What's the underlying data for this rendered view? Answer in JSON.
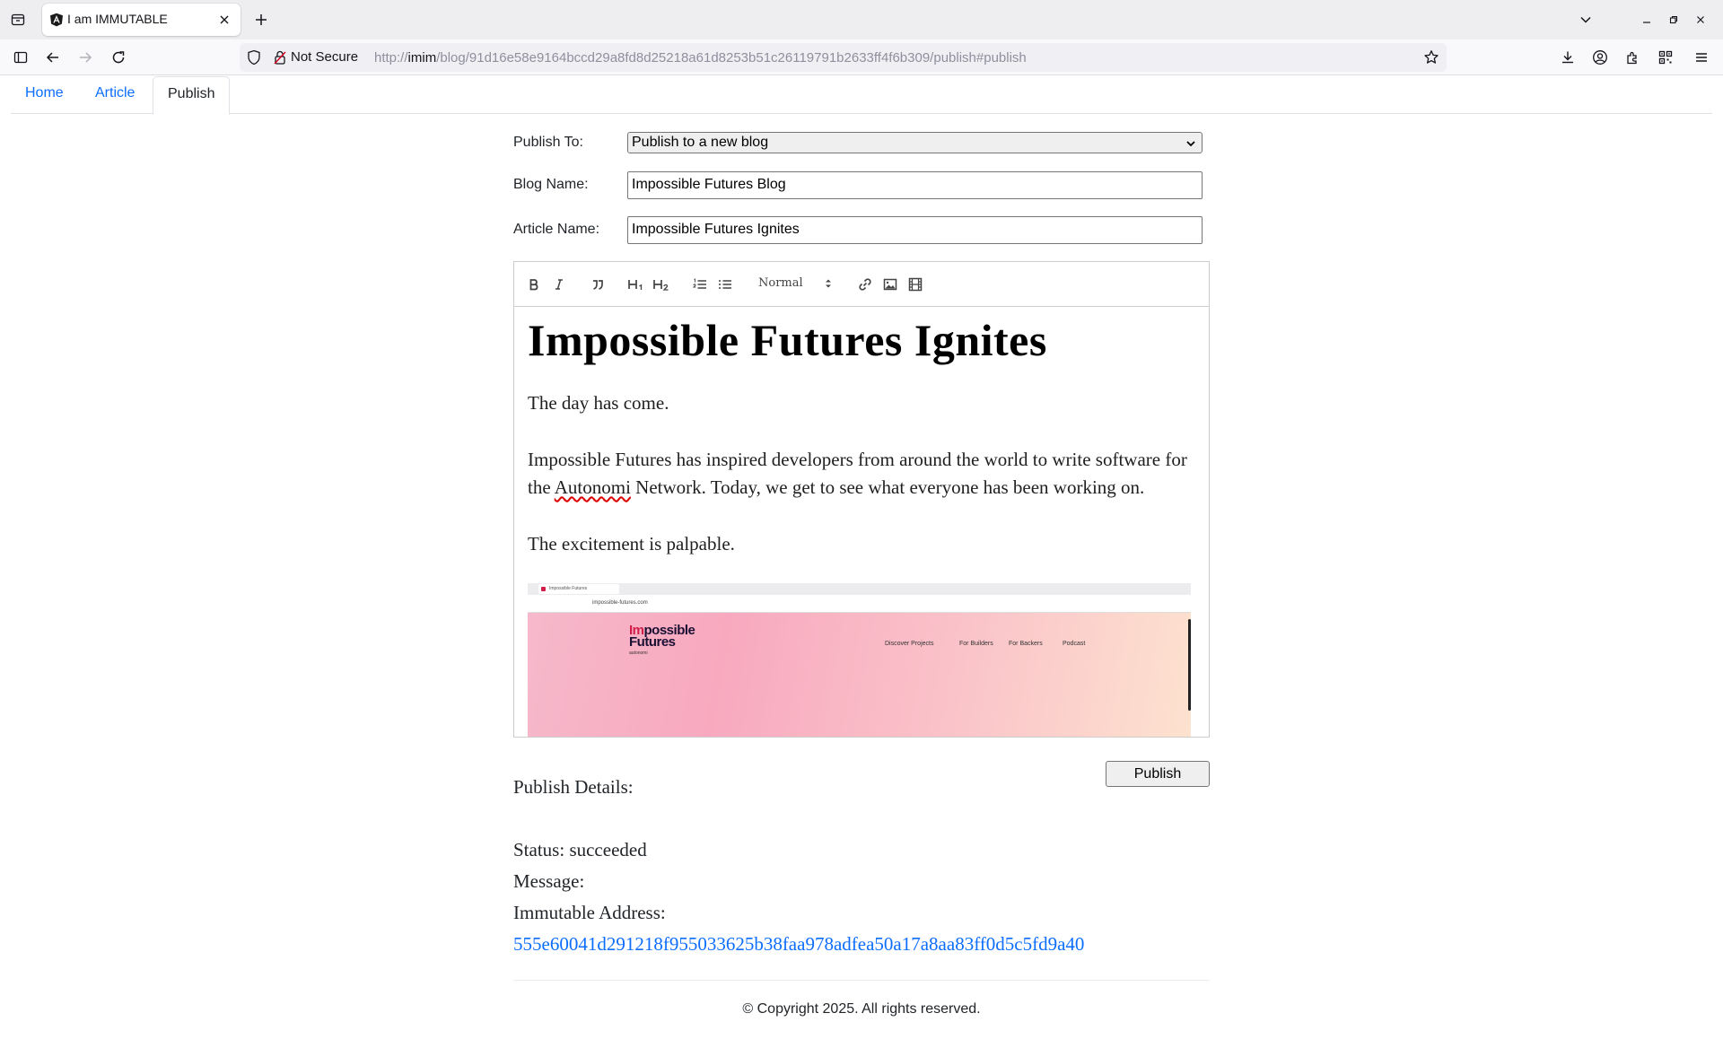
{
  "browser": {
    "tab_title": "I am IMMUTABLE",
    "security_label": "Not Secure",
    "url_prefix": "http://",
    "url_host": "imim",
    "url_path": "/blog/91d16e58e9164bccd29a8fd8d25218a61d8253b51c26119791b2633ff4f6b309/publish#publish"
  },
  "nav": {
    "tabs": [
      {
        "label": "Home"
      },
      {
        "label": "Article"
      },
      {
        "label": "Publish"
      }
    ],
    "active_tab": "Publish"
  },
  "form": {
    "publish_to_label": "Publish To:",
    "publish_to_value": "Publish to a new blog",
    "blog_name_label": "Blog Name:",
    "blog_name_value": "Impossible Futures Blog",
    "article_name_label": "Article Name:",
    "article_name_value": "Impossible Futures Ignites"
  },
  "editor": {
    "toolbar": {
      "bold_icon": "bold-icon",
      "italic_icon": "italic-icon",
      "quote_icon": "blockquote-icon",
      "h1_label": "H1",
      "h2_label": "H2",
      "ordered_list_icon": "ordered-list-icon",
      "bullet_list_icon": "bullet-list-icon",
      "size_value": "Normal",
      "link_icon": "link-icon",
      "image_icon": "image-icon",
      "video_icon": "video-icon"
    },
    "heading": "Impossible Futures Ignites",
    "paragraph_1": "The day has come.",
    "paragraph_2_before": "Impossible Futures has inspired developers from around the world to write software for the ",
    "paragraph_2_misspelled": "Autonomi",
    "paragraph_2_after": " Network. Today, we get to see what everyone has been working on.",
    "paragraph_3": "The excitement is palpable.",
    "embedded_screenshot": {
      "tab_title": "Impossible Futures",
      "url": "impossible-futures.com",
      "logo_line_1_accent": "Im",
      "logo_line_1_rest": "possible",
      "logo_line_2": "Futures",
      "logo_sub": "autonomi",
      "menu": [
        "Discover Projects",
        "For Builders",
        "For Backers",
        "Podcast"
      ]
    }
  },
  "actions": {
    "publish_label": "Publish"
  },
  "details": {
    "heading": "Publish Details:",
    "status_label": "Status:",
    "status_value": "succeeded",
    "message_label": "Message:",
    "message_value": "",
    "address_label": "Immutable Address:",
    "address_value": "555e60041d291218f955033625b38faa978adfea50a17a8aa83ff0d5c5fd9a40"
  },
  "footer": {
    "copyright": "© Copyright 2025. All rights reserved."
  },
  "colors": {
    "link": "#0d6efd",
    "spellcheck": "#d00000"
  }
}
